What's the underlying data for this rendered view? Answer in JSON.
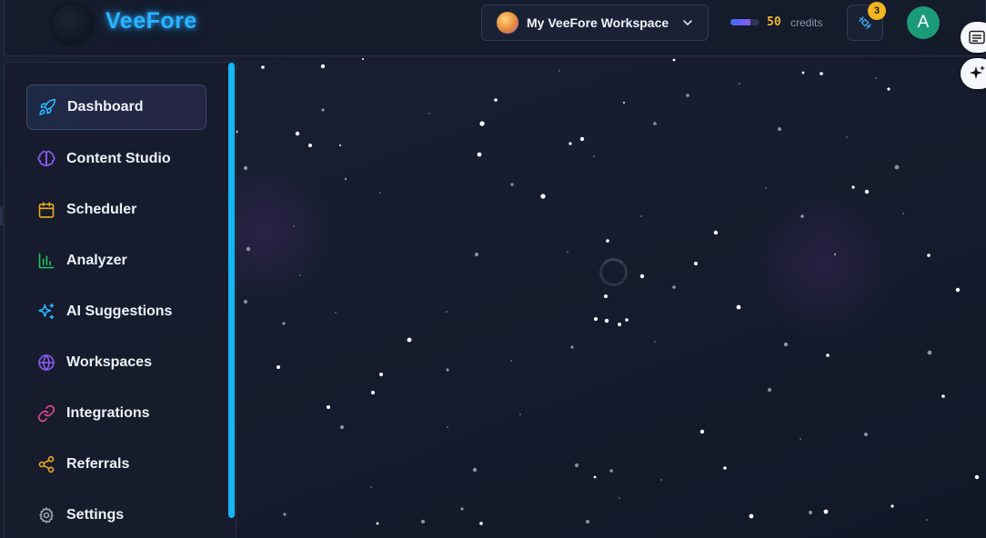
{
  "header": {
    "brand": "VeeFore",
    "workspace_name": "My VeeFore Workspace",
    "credits_value": "50",
    "credits_label": "credits",
    "credits_level": 0.7,
    "notification_count": "3",
    "user_initial": "A"
  },
  "sidebar": {
    "items": [
      {
        "label": "Dashboard",
        "icon": "rocket-icon",
        "active": true,
        "color": "#2bb4ff"
      },
      {
        "label": "Content Studio",
        "icon": "brain-icon",
        "active": false,
        "color": "#8b5cf6"
      },
      {
        "label": "Scheduler",
        "icon": "calendar-icon",
        "active": false,
        "color": "#f0a81f"
      },
      {
        "label": "Analyzer",
        "icon": "bar-chart-icon",
        "active": false,
        "color": "#22c55e"
      },
      {
        "label": "AI Suggestions",
        "icon": "sparkles-icon",
        "active": false,
        "color": "#2bb4ff"
      },
      {
        "label": "Workspaces",
        "icon": "globe-icon",
        "active": false,
        "color": "#8b5cf6"
      },
      {
        "label": "Integrations",
        "icon": "link-icon",
        "active": false,
        "color": "#ec4899"
      },
      {
        "label": "Referrals",
        "icon": "share-icon",
        "active": false,
        "color": "#f0a81f"
      },
      {
        "label": "Settings",
        "icon": "gear-icon",
        "active": false,
        "color": "#9aa3b5"
      }
    ]
  },
  "colors": {
    "brand": "#2bb4ff",
    "background": "#141a2b",
    "scrollbar": "#14b6f5",
    "badge": "#f1b521",
    "avatar": "#1b9a78"
  }
}
